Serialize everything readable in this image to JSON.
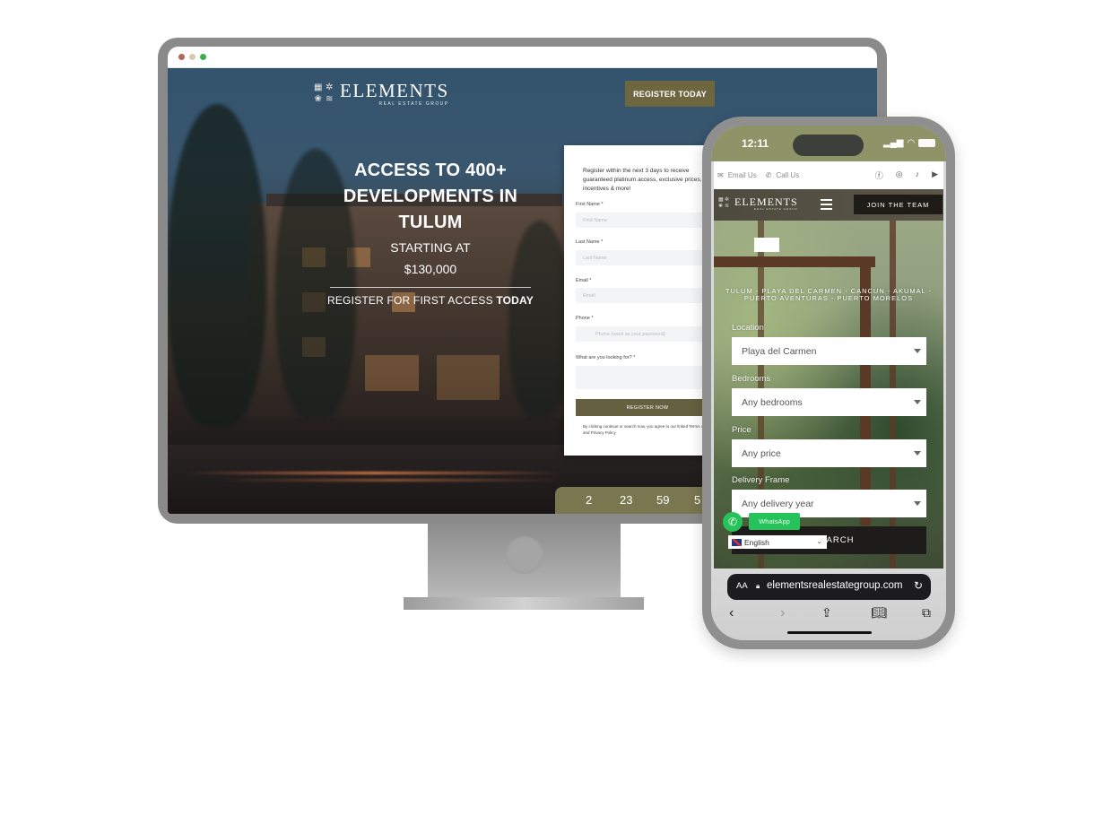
{
  "desktop": {
    "browser_dots": [
      "#b5655a",
      "#d6caa8",
      "#39b04d"
    ],
    "brand": {
      "name": "ELEMENTS",
      "tagline": "REAL ESTATE GROUP"
    },
    "header_cta": "REGISTER TODAY",
    "hero": {
      "title": "ACCESS TO 400+ DEVELOPMENTS IN TULUM",
      "starting_label": "STARTING AT",
      "price": "$130,000",
      "cta_prefix": "REGISTER FOR FIRST ACCESS ",
      "cta_emphasis": "TODAY"
    },
    "form": {
      "intro": "Register within the next 3 days to receive guaranteed platinum access, exclusive prices, incentives & more!",
      "fields": [
        {
          "label": "First Name *",
          "placeholder": "First Name"
        },
        {
          "label": "Last Name *",
          "placeholder": "Last Name"
        },
        {
          "label": "Email *",
          "placeholder": "Email"
        },
        {
          "label": "Phone *",
          "placeholder": "Phone (used as your password)"
        },
        {
          "label": "What are you looking for? *",
          "placeholder": ""
        }
      ],
      "submit": "REGISTER NOW",
      "terms": "By clicking continue or search now, you agree to our linked Terms of Use and Privacy Policy"
    },
    "countdown": [
      "2",
      "23",
      "59",
      "5"
    ],
    "accent_color": "#6d663e"
  },
  "phone": {
    "status": {
      "time": "12:11"
    },
    "topbar": {
      "email": "Email Us",
      "call": "Call Us",
      "social": [
        "facebook-icon",
        "instagram-icon",
        "tiktok-icon",
        "youtube-icon"
      ]
    },
    "brand": {
      "name": "ELEMENTS",
      "tagline": "REAL ESTATE GROUP"
    },
    "join_button": "JOIN THE TEAM",
    "cities_line1": "TULUM - PLAYA DEL CARMEN - CANCUN - AKUMAL -",
    "cities_line2": "PUERTO AVENTURAS - PUERTO MORELOS",
    "filters": [
      {
        "label": "Location",
        "value": "Playa del Carmen"
      },
      {
        "label": "Bedrooms",
        "value": "Any bedrooms"
      },
      {
        "label": "Price",
        "value": "Any price"
      },
      {
        "label": "Delivery Frame",
        "value": "Any delivery year"
      }
    ],
    "search_button": "SEARCH",
    "whatsapp_label": "WhatsApp",
    "language": "English",
    "safari": {
      "aa": "AA",
      "url": "elementsrealestategroup.com"
    }
  }
}
